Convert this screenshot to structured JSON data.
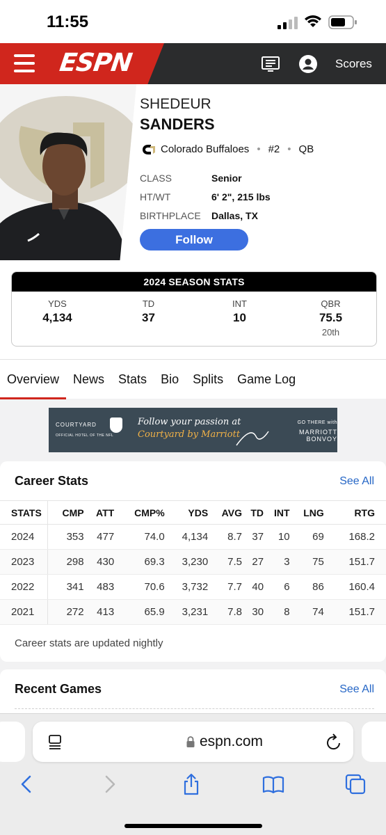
{
  "status_bar": {
    "time": "11:55"
  },
  "header": {
    "logo": "ESPN",
    "scores_label": "Scores"
  },
  "player": {
    "first_name": "SHEDEUR",
    "last_name": "SANDERS",
    "team": "Colorado Buffaloes",
    "number": "#2",
    "position": "QB",
    "info": [
      {
        "label": "CLASS",
        "value": "Senior"
      },
      {
        "label": "HT/WT",
        "value": "6' 2\", 215 lbs"
      },
      {
        "label": "BIRTHPLACE",
        "value": "Dallas, TX"
      }
    ],
    "follow_label": "Follow"
  },
  "season_stats": {
    "title": "2024 SEASON STATS",
    "stats": [
      {
        "label": "YDS",
        "value": "4,134",
        "rank": ""
      },
      {
        "label": "TD",
        "value": "37",
        "rank": ""
      },
      {
        "label": "INT",
        "value": "10",
        "rank": ""
      },
      {
        "label": "QBR",
        "value": "75.5",
        "rank": "20th"
      }
    ]
  },
  "tabs": [
    "Overview",
    "News",
    "Stats",
    "Bio",
    "Splits",
    "Game Log"
  ],
  "ad": {
    "brand": "COURTYARD",
    "brand_sub": "OFFICIAL HOTEL OF THE NFL",
    "line1": "Follow your passion at",
    "line2": "Courtyard by Marriott",
    "cta_small": "GO THERE with",
    "cta_big": "MARRIOTT BONVOY"
  },
  "career_stats": {
    "title": "Career Stats",
    "see_all": "See All",
    "columns": [
      "STATS",
      "CMP",
      "ATT",
      "CMP%",
      "YDS",
      "AVG",
      "TD",
      "INT",
      "LNG",
      "RTG"
    ],
    "rows": [
      [
        "2024",
        "353",
        "477",
        "74.0",
        "4,134",
        "8.7",
        "37",
        "10",
        "69",
        "168.2"
      ],
      [
        "2023",
        "298",
        "430",
        "69.3",
        "3,230",
        "7.5",
        "27",
        "3",
        "75",
        "151.7"
      ],
      [
        "2022",
        "341",
        "483",
        "70.6",
        "3,732",
        "7.7",
        "40",
        "6",
        "86",
        "160.4"
      ],
      [
        "2021",
        "272",
        "413",
        "65.9",
        "3,231",
        "7.8",
        "30",
        "8",
        "74",
        "151.7"
      ]
    ],
    "note": "Career stats are updated nightly"
  },
  "recent_games": {
    "title": "Recent Games",
    "see_all": "See All"
  },
  "browser": {
    "url": "espn.com"
  },
  "colors": {
    "espn_red": "#d0261d",
    "follow_blue": "#3c6fe0",
    "link_blue": "#2566c6"
  }
}
